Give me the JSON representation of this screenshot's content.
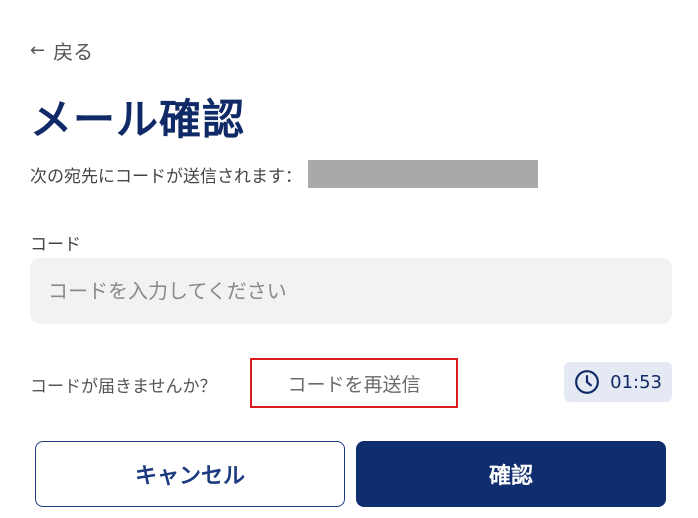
{
  "header": {
    "back_label": "戻る",
    "back_icon": "arrow-left-icon",
    "title": "メール確認"
  },
  "recipient": {
    "message": "次の宛先にコードが送信されます："
  },
  "code_field": {
    "label": "コード",
    "placeholder": "コードを入力してください",
    "value": ""
  },
  "resend": {
    "question": "コードが届きませんか？",
    "button_label": "コードを再送信",
    "timer": "01:53",
    "timer_icon": "clock-icon"
  },
  "actions": {
    "cancel_label": "キャンセル",
    "confirm_label": "確認"
  },
  "colors": {
    "primary": "#0f2e6f",
    "title": "#0f2a66",
    "highlight_border": "#d81b1b",
    "input_bg": "#f1f2f3",
    "timer_bg": "#e4e9f3"
  }
}
